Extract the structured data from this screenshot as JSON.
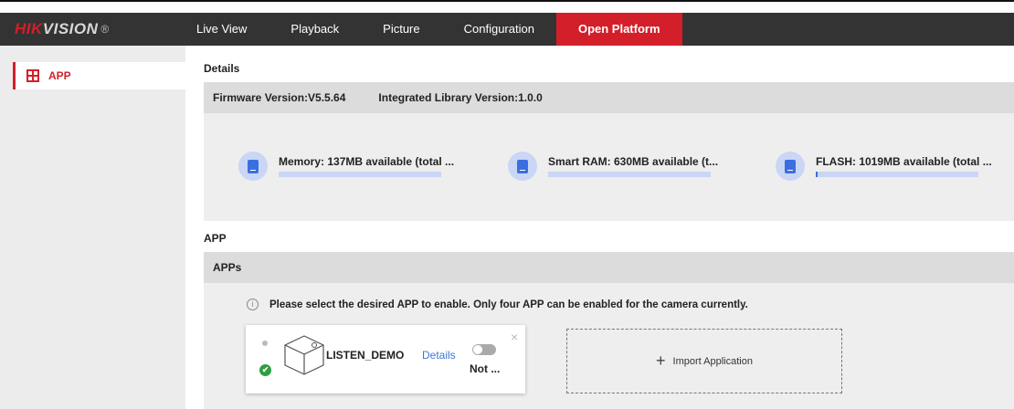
{
  "brand": {
    "logo_red": "HIK",
    "logo_rest": "VISION",
    "logo_mark": "®"
  },
  "nav": [
    {
      "label": "Live View",
      "active": false
    },
    {
      "label": "Playback",
      "active": false
    },
    {
      "label": "Picture",
      "active": false
    },
    {
      "label": "Configuration",
      "active": false
    },
    {
      "label": "Open Platform",
      "active": true
    }
  ],
  "sidebar": {
    "items": [
      {
        "label": "APP",
        "icon": "app-grid-icon"
      }
    ]
  },
  "details": {
    "title": "Details",
    "firmware": "Firmware Version:V5.5.64",
    "library": "Integrated Library Version:1.0.0",
    "stats": [
      {
        "label": "Memory:  137MB available (total ...",
        "percent": 100
      },
      {
        "label": "Smart RAM:  630MB available (t...",
        "percent": 100
      },
      {
        "label": "FLASH:  1019MB available (total ...",
        "percent": 1
      }
    ]
  },
  "app_section": {
    "title": "APP",
    "bar_label": "APPs",
    "info_text": "Please select the desired APP to enable. Only four APP can be enabled for the camera currently.",
    "card": {
      "name": "LISTEN_DEMO",
      "details_link": "Details",
      "status": "Not ...",
      "close": "×",
      "check": "✔"
    },
    "import_label": "Import Application",
    "import_plus": "+"
  },
  "colors": {
    "accent": "#d31f2a",
    "topbar": "#333333",
    "blue": "#3b6fe0"
  }
}
